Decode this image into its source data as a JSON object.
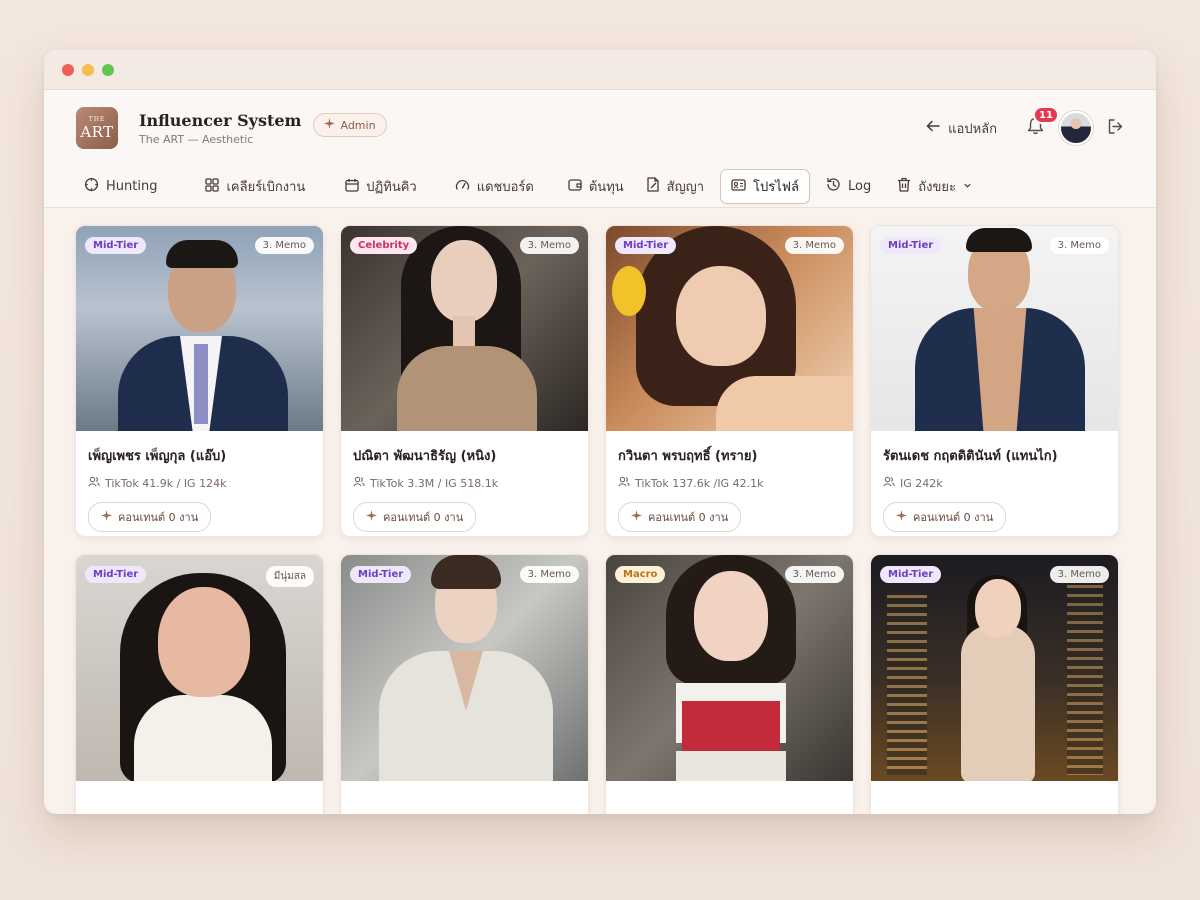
{
  "window": {
    "dots": [
      "#ee5f57",
      "#f5bd4f",
      "#61c554"
    ]
  },
  "header": {
    "logo_top": "THE",
    "logo_bottom": "ART",
    "title": "Influencer System",
    "subtitle": "The ART — Aesthetic",
    "badge": "Admin",
    "back_label": "แอปหลัก",
    "notification_count": "11"
  },
  "nav": {
    "items": [
      {
        "label": "Hunting",
        "icon": "crosshair-icon"
      },
      {
        "label": "เคลียร์เบิกงาน",
        "icon": "grid-icon"
      },
      {
        "label": "ปฏิทินคิว",
        "icon": "calendar-icon"
      },
      {
        "label": "แดชบอร์ด",
        "icon": "gauge-icon"
      },
      {
        "label": "ต้นทุน",
        "icon": "wallet-icon"
      },
      {
        "label": "สัญญา",
        "icon": "contract-icon"
      },
      {
        "label": "โปรไฟล์",
        "icon": "profile-card-icon",
        "active": true
      },
      {
        "label": "Log",
        "icon": "history-icon"
      },
      {
        "label": "ถังขยะ",
        "icon": "trash-icon"
      }
    ]
  },
  "cards": [
    {
      "tier": "Mid-Tier",
      "tag": "3. Memo",
      "name": "เพ็ญเพชร เพ็ญกุล (แอ๊บ)",
      "stats": "TikTok 41.9k / IG 124k",
      "button": "คอนเทนต์ 0 งาน"
    },
    {
      "tier": "Celebrity",
      "tag": "3. Memo",
      "name": "ปณิตา พัฒนาธิรัญ (หนิง)",
      "stats": "TikTok 3.3M / IG 518.1k",
      "button": "คอนเทนต์ 0 งาน"
    },
    {
      "tier": "Mid-Tier",
      "tag": "3. Memo",
      "name": "กวินตา พรบฤทธิ์ (ทราย)",
      "stats": "TikTok 137.6k /IG 42.1k",
      "button": "คอนเทนต์ 0 งาน"
    },
    {
      "tier": "Mid-Tier",
      "tag": "3. Memo",
      "name": "รัตนเดช กฤตดิตินันท์ (แทนไก)",
      "stats": "IG 242k",
      "button": "คอนเทนต์ 0 งาน"
    },
    {
      "tier": "Mid-Tier",
      "tag": "มีนุ่มสล",
      "name": "",
      "stats": "",
      "button": ""
    },
    {
      "tier": "Mid-Tier",
      "tag": "3. Memo",
      "name": "",
      "stats": "",
      "button": ""
    },
    {
      "tier": "Macro",
      "tag": "3. Memo",
      "name": "",
      "stats": "",
      "button": ""
    },
    {
      "tier": "Mid-Tier",
      "tag": "3. Memo",
      "name": "",
      "stats": "",
      "button": ""
    }
  ],
  "colors": {
    "accent": "#8c5d4a",
    "tier_mid": "#6b3fc0",
    "tier_celebrity": "#d0306a",
    "tier_macro": "#b8741a",
    "badge_red": "#e53953"
  }
}
